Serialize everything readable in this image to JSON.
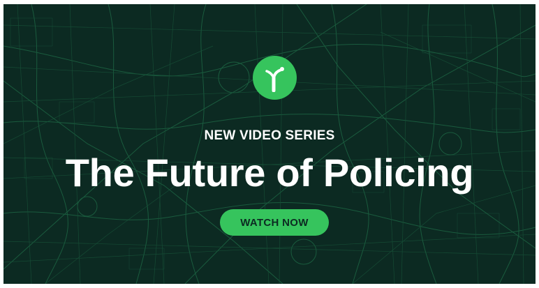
{
  "banner": {
    "eyebrow": "NEW VIDEO SERIES",
    "headline": "The Future of Policing",
    "cta_label": "WATCH NOW",
    "logo_icon": "sprout-icon",
    "background_icon": "street-map-pattern"
  },
  "colors": {
    "background": "#0c2a22",
    "accent": "#36c45d",
    "text": "#ffffff",
    "map_lines": "#1f6a45"
  }
}
